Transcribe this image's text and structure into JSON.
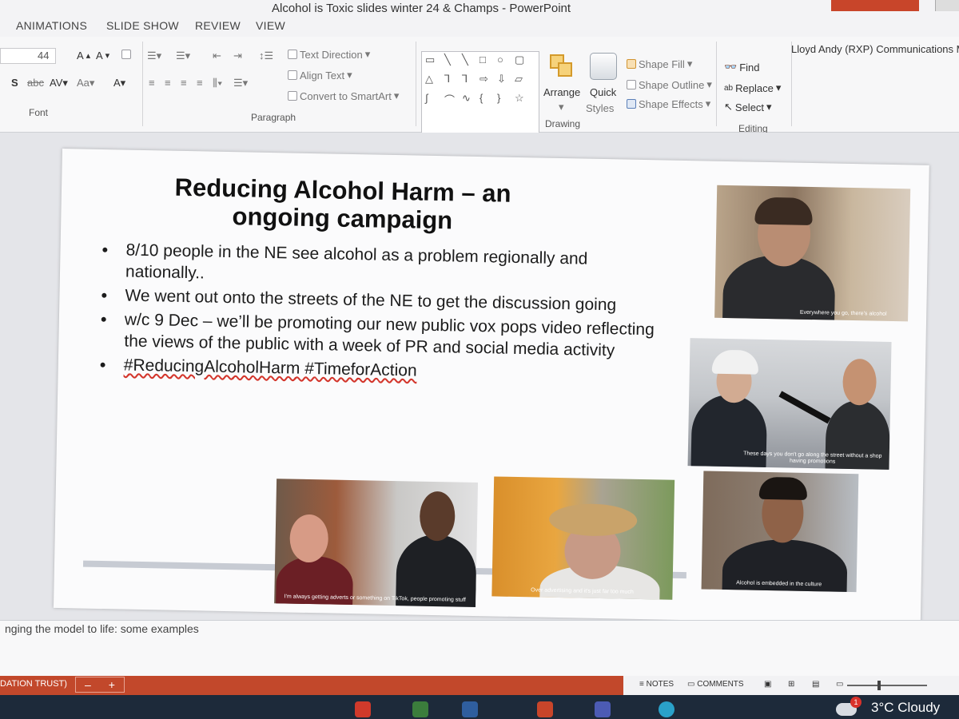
{
  "window": {
    "title": "Alcohol is Toxic slides winter 24 & Champs - PowerPoint"
  },
  "tabs": [
    "ANIMATIONS",
    "SLIDE SHOW",
    "REVIEW",
    "VIEW"
  ],
  "account": "Lloyd Andy (RXP) Communications M",
  "ribbon": {
    "font": {
      "size_value": "44",
      "group_label": "Font"
    },
    "paragraph": {
      "text_direction": "Text Direction",
      "align_text": "Align Text",
      "convert_smartart": "Convert to SmartArt",
      "group_label": "Paragraph"
    },
    "drawing": {
      "arrange": "Arrange",
      "quick_styles_1": "Quick",
      "quick_styles_2": "Styles",
      "shape_fill": "Shape Fill",
      "shape_outline": "Shape Outline",
      "shape_effects": "Shape Effects",
      "group_label": "Drawing"
    },
    "editing": {
      "find": "Find",
      "replace": "Replace",
      "select": "Select",
      "group_label": "Editing"
    }
  },
  "slide": {
    "title_line1": "Reducing Alcohol Harm – an",
    "title_line2": "ongoing campaign",
    "bullets": [
      "8/10 people in the NE see alcohol as a problem regionally and nationally..",
      "We went out onto the streets of the NE to get the discussion going",
      "w/c 9 Dec – we’ll be promoting our new public vox pops video reflecting the views of the public with a week of PR and social media activity",
      "#ReducingAlcoholHarm #TimeforAction"
    ],
    "photos": [
      {
        "caption": "Everywhere you go, there's alcohol"
      },
      {
        "caption": "These days you don't go along the street without a shop having promotions"
      },
      {
        "caption": "I'm always getting adverts or something on TikTok, people promoting stuff"
      },
      {
        "caption": "Over advertising and it's just far too much"
      },
      {
        "caption": "Alcohol is embedded in the culture"
      }
    ]
  },
  "notes": {
    "text": "nging the model to life: some examples"
  },
  "status": {
    "left_label": "DATION TRUST)",
    "notes_label": "NOTES",
    "comments_label": "COMMENTS"
  },
  "taskbar": {
    "temperature": "3°C",
    "condition": "Cloudy",
    "notification_count": "1"
  },
  "colors": {
    "status_bar": "#c2482b",
    "taskbar": "#1d2a3a",
    "accent_orange": "#d49a2b"
  }
}
